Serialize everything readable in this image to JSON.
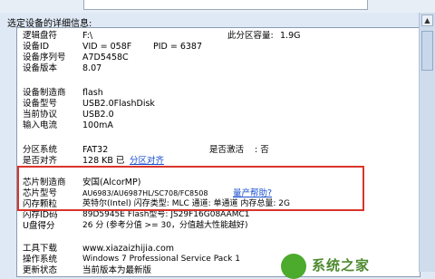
{
  "section_title": "选定设备的详细信息:",
  "rows": [
    {
      "label": "逻辑盘符",
      "value": "F:\\",
      "label2": "此分区容量:",
      "value2": "1.9G"
    },
    {
      "label": "设备ID",
      "value": "VID = 058F",
      "label2": "PID = 6387",
      "value2": ""
    },
    {
      "label": "设备序列号",
      "value": "A7D5458C"
    },
    {
      "label": "设备版本",
      "value": "8.07"
    },
    {
      "label": "设备制造商",
      "value": "flash"
    },
    {
      "label": "设备型号",
      "value": "USB2.0FlashDisk"
    },
    {
      "label": "当前协议",
      "value": "USB2.0"
    },
    {
      "label": "输入电流",
      "value": "100mA"
    },
    {
      "label": "分区系统",
      "value": "FAT32",
      "label2": "是否激活",
      "value2": ": 否"
    },
    {
      "label": "是否对齐",
      "value": "128 KB 已",
      "link": "分区对齐"
    },
    {
      "label": "芯片制造商",
      "value": "安国(AlcorMP)"
    },
    {
      "label": "芯片型号",
      "value": "AU6983/AU6987HL/SC708/FC8508",
      "link": "量产帮助?"
    },
    {
      "label": "闪存颗粒",
      "value": "英特尔(Intel)   闪存类型: MLC   通道: 单通道   内存总量: 2G"
    },
    {
      "label": "闪存ID码",
      "value": "89D5945E            Flash型号: JS29F16G08AAMC1"
    },
    {
      "label": "U盘得分",
      "value": "26 分            (参考分值 >= 30，分值越大性能越好)"
    },
    {
      "label": "工具下载",
      "value": "www.xiazaizhijia.com"
    },
    {
      "label": "操作系统",
      "value": "Windows 7 Professional Service Pack 1"
    },
    {
      "label": "更新状态",
      "value": "当前版本为最新版"
    }
  ],
  "watermark": {
    "text": "系统之家",
    "color": "#4caa2c"
  },
  "highlight_color": "#d9342b"
}
